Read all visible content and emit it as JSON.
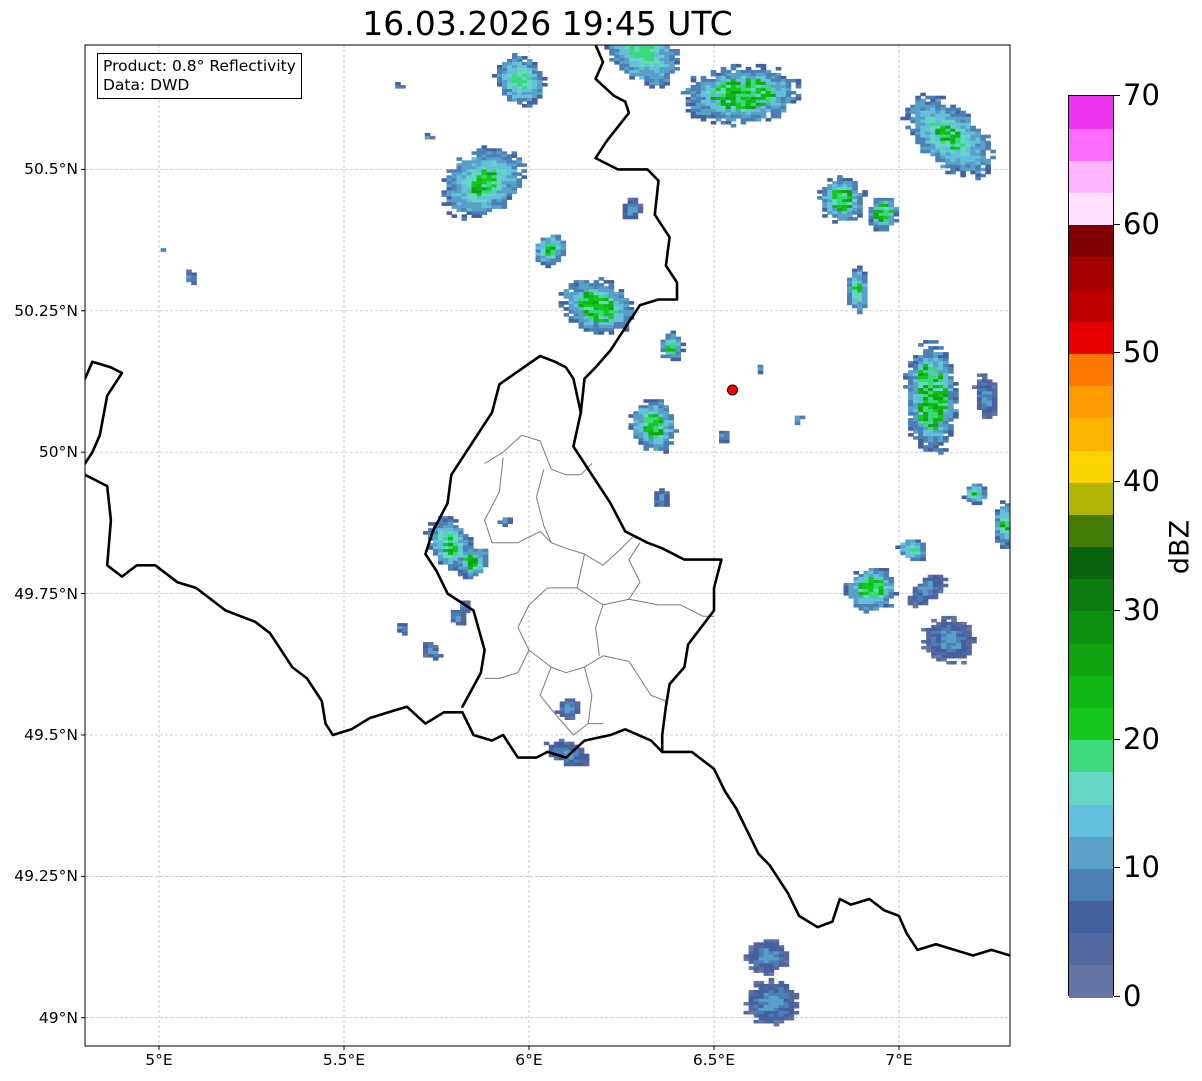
{
  "title": "16.03.2026 19:45 UTC",
  "info": {
    "product": "Product: 0.8° Reflectivity",
    "data": "Data: DWD"
  },
  "map": {
    "lon_range": [
      4.8,
      7.3
    ],
    "lat_range": [
      48.95,
      50.72
    ],
    "x_ticks": [
      {
        "lon": 5.0,
        "label": "5°E"
      },
      {
        "lon": 5.5,
        "label": "5.5°E"
      },
      {
        "lon": 6.0,
        "label": "6°E"
      },
      {
        "lon": 6.5,
        "label": "6.5°E"
      },
      {
        "lon": 7.0,
        "label": "7°E"
      }
    ],
    "y_ticks": [
      {
        "lat": 50.5,
        "label": "50.5°N"
      },
      {
        "lat": 50.25,
        "label": "50.25°N"
      },
      {
        "lat": 50.0,
        "label": "50°N"
      },
      {
        "lat": 49.75,
        "label": "49.75°N"
      },
      {
        "lat": 49.5,
        "label": "49.5°N"
      },
      {
        "lat": 49.25,
        "label": "49.25°N"
      },
      {
        "lat": 49.0,
        "label": "49°N"
      }
    ],
    "radar_site": {
      "lon": 6.55,
      "lat": 50.11
    },
    "colors": {
      "border": "#000000",
      "internal_border": "#7a7a7a",
      "grid": "#b4b4b4",
      "marker": "#ff0000"
    },
    "echoes": [
      {
        "lon": 6.3,
        "lat": 50.71,
        "rlon": 0.11,
        "rlat": 0.05,
        "rot": 40,
        "level": 1,
        "core": 0
      },
      {
        "lon": 6.57,
        "lat": 50.635,
        "rlon": 0.16,
        "rlat": 0.05,
        "rot": -5,
        "level": 1,
        "core": 0.55
      },
      {
        "lon": 5.87,
        "lat": 50.48,
        "rlon": 0.12,
        "rlat": 0.055,
        "rot": -35,
        "level": 1,
        "core": 0.35
      },
      {
        "lon": 5.97,
        "lat": 50.66,
        "rlon": 0.07,
        "rlat": 0.04,
        "rot": 40,
        "level": 1,
        "core": 0
      },
      {
        "lon": 6.05,
        "lat": 50.36,
        "rlon": 0.04,
        "rlat": 0.03,
        "rot": 60,
        "level": 1,
        "core": 0.3
      },
      {
        "lon": 6.18,
        "lat": 50.26,
        "rlon": 0.1,
        "rlat": 0.045,
        "rot": 20,
        "level": 1,
        "core": 0.55
      },
      {
        "lon": 6.27,
        "lat": 50.43,
        "rlon": 0.03,
        "rlat": 0.02,
        "rot": 0,
        "level": 0,
        "core": 0
      },
      {
        "lon": 6.38,
        "lat": 50.19,
        "rlon": 0.03,
        "rlat": 0.025,
        "rot": 0,
        "level": 1,
        "core": 0.5
      },
      {
        "lon": 6.33,
        "lat": 50.05,
        "rlon": 0.075,
        "rlat": 0.04,
        "rot": 70,
        "level": 1,
        "core": 0.45
      },
      {
        "lon": 6.35,
        "lat": 49.92,
        "rlon": 0.025,
        "rlat": 0.015,
        "rot": 80,
        "level": 0,
        "core": 0
      },
      {
        "lon": 6.62,
        "lat": 50.15,
        "rlon": 0.012,
        "rlat": 0.01,
        "rot": 0,
        "level": 0,
        "core": 0
      },
      {
        "lon": 6.52,
        "lat": 50.03,
        "rlon": 0.02,
        "rlat": 0.01,
        "rot": 40,
        "level": 0,
        "core": 0
      },
      {
        "lon": 6.72,
        "lat": 50.06,
        "rlon": 0.012,
        "rlat": 0.01,
        "rot": 0,
        "level": 0,
        "core": 0
      },
      {
        "lon": 6.84,
        "lat": 50.45,
        "rlon": 0.06,
        "rlat": 0.04,
        "rot": -30,
        "level": 1,
        "core": 0.5
      },
      {
        "lon": 6.95,
        "lat": 50.425,
        "rlon": 0.04,
        "rlat": 0.03,
        "rot": 20,
        "level": 1,
        "core": 0.55
      },
      {
        "lon": 6.88,
        "lat": 50.29,
        "rlon": 0.03,
        "rlat": 0.04,
        "rot": 0,
        "level": 1,
        "core": 0.3
      },
      {
        "lon": 7.13,
        "lat": 50.56,
        "rlon": 0.14,
        "rlat": 0.05,
        "rot": 40,
        "level": 1,
        "core": 0.3
      },
      {
        "lon": 7.08,
        "lat": 50.1,
        "rlon": 0.15,
        "rlat": 0.045,
        "rot": 88,
        "level": 1,
        "core": 0.6
      },
      {
        "lon": 7.23,
        "lat": 50.1,
        "rlon": 0.06,
        "rlat": 0.02,
        "rot": 80,
        "level": 0,
        "core": 0
      },
      {
        "lon": 7.2,
        "lat": 49.93,
        "rlon": 0.03,
        "rlat": 0.02,
        "rot": 0,
        "level": 1,
        "core": 0.2
      },
      {
        "lon": 7.28,
        "lat": 49.875,
        "rlon": 0.03,
        "rlat": 0.04,
        "rot": 0,
        "level": 1,
        "core": 0.3
      },
      {
        "lon": 7.03,
        "lat": 49.83,
        "rlon": 0.04,
        "rlat": 0.02,
        "rot": 20,
        "level": 1,
        "core": 0
      },
      {
        "lon": 6.92,
        "lat": 49.76,
        "rlon": 0.07,
        "rlat": 0.04,
        "rot": -10,
        "level": 1,
        "core": 0.5
      },
      {
        "lon": 7.07,
        "lat": 49.76,
        "rlon": 0.06,
        "rlat": 0.02,
        "rot": -40,
        "level": 0,
        "core": 0
      },
      {
        "lon": 7.13,
        "lat": 49.67,
        "rlon": 0.07,
        "rlat": 0.04,
        "rot": 20,
        "level": 0,
        "core": 0
      },
      {
        "lon": 5.78,
        "lat": 49.84,
        "rlon": 0.08,
        "rlat": 0.035,
        "rot": 60,
        "level": 1,
        "core": 0.4
      },
      {
        "lon": 5.84,
        "lat": 49.81,
        "rlon": 0.04,
        "rlat": 0.03,
        "rot": 50,
        "level": 1,
        "core": 0.5
      },
      {
        "lon": 5.8,
        "lat": 49.71,
        "rlon": 0.025,
        "rlat": 0.012,
        "rot": 60,
        "level": 0,
        "core": 0
      },
      {
        "lon": 5.73,
        "lat": 49.65,
        "rlon": 0.03,
        "rlat": 0.012,
        "rot": 45,
        "level": 0,
        "core": 0
      },
      {
        "lon": 5.65,
        "lat": 49.69,
        "rlon": 0.02,
        "rlat": 0.01,
        "rot": 60,
        "level": 0,
        "core": 0
      },
      {
        "lon": 6.1,
        "lat": 49.55,
        "rlon": 0.03,
        "rlat": 0.02,
        "rot": 70,
        "level": 0,
        "core": 0
      },
      {
        "lon": 6.1,
        "lat": 49.47,
        "rlon": 0.06,
        "rlat": 0.02,
        "rot": 20,
        "level": 0,
        "core": 0
      },
      {
        "lon": 6.64,
        "lat": 49.11,
        "rlon": 0.06,
        "rlat": 0.03,
        "rot": 0,
        "level": 0,
        "core": 0
      },
      {
        "lon": 6.65,
        "lat": 49.03,
        "rlon": 0.07,
        "rlat": 0.04,
        "rot": 0,
        "level": 0,
        "core": 0
      },
      {
        "lon": 5.93,
        "lat": 49.88,
        "rlon": 0.015,
        "rlat": 0.01,
        "rot": 0,
        "level": 0,
        "core": 0
      },
      {
        "lon": 5.82,
        "lat": 49.73,
        "rlon": 0.02,
        "rlat": 0.01,
        "rot": 40,
        "level": 0,
        "core": 0
      },
      {
        "lon": 5.08,
        "lat": 50.31,
        "rlon": 0.02,
        "rlat": 0.008,
        "rot": 70,
        "level": 0,
        "core": 0
      },
      {
        "lon": 5.0,
        "lat": 50.36,
        "rlon": 0.008,
        "rlat": 0.006,
        "rot": 0,
        "level": 0,
        "core": 0
      },
      {
        "lon": 5.64,
        "lat": 50.65,
        "rlon": 0.015,
        "rlat": 0.006,
        "rot": 30,
        "level": 0,
        "core": 0
      },
      {
        "lon": 5.72,
        "lat": 50.56,
        "rlon": 0.015,
        "rlat": 0.006,
        "rot": 30,
        "level": 0,
        "core": 0
      }
    ],
    "intl_border": [
      [
        [
          4.8,
          50.13
        ],
        [
          4.82,
          50.16
        ],
        [
          4.87,
          50.15
        ],
        [
          4.9,
          50.14
        ],
        [
          4.86,
          50.1
        ],
        [
          4.84,
          50.03
        ],
        [
          4.82,
          50.0
        ],
        [
          4.8,
          49.98
        ]
      ],
      [
        [
          4.8,
          49.96
        ],
        [
          4.86,
          49.94
        ],
        [
          4.87,
          49.88
        ],
        [
          4.86,
          49.8
        ],
        [
          4.9,
          49.78
        ],
        [
          4.94,
          49.8
        ],
        [
          4.99,
          49.8
        ],
        [
          5.05,
          49.77
        ],
        [
          5.1,
          49.76
        ],
        [
          5.18,
          49.72
        ],
        [
          5.26,
          49.7
        ],
        [
          5.3,
          49.68
        ],
        [
          5.33,
          49.65
        ],
        [
          5.36,
          49.62
        ],
        [
          5.4,
          49.6
        ],
        [
          5.44,
          49.56
        ],
        [
          5.45,
          49.52
        ],
        [
          5.47,
          49.5
        ],
        [
          5.52,
          49.51
        ],
        [
          5.57,
          49.53
        ],
        [
          5.62,
          49.54
        ],
        [
          5.67,
          49.55
        ],
        [
          5.72,
          49.52
        ],
        [
          5.77,
          49.54
        ],
        [
          5.82,
          49.54
        ],
        [
          5.85,
          49.5
        ],
        [
          5.9,
          49.49
        ],
        [
          5.93,
          49.5
        ],
        [
          5.97,
          49.46
        ],
        [
          6.02,
          49.46
        ],
        [
          6.05,
          49.47
        ],
        [
          6.1,
          49.46
        ],
        [
          6.15,
          49.49
        ],
        [
          6.22,
          49.5
        ],
        [
          6.26,
          49.51
        ],
        [
          6.33,
          49.49
        ],
        [
          6.36,
          49.47
        ],
        [
          6.39,
          49.47
        ],
        [
          6.44,
          49.47
        ],
        [
          6.5,
          49.44
        ],
        [
          6.53,
          49.4
        ],
        [
          6.56,
          49.37
        ],
        [
          6.59,
          49.33
        ],
        [
          6.62,
          49.29
        ],
        [
          6.65,
          49.27
        ],
        [
          6.7,
          49.22
        ],
        [
          6.73,
          49.18
        ],
        [
          6.78,
          49.16
        ],
        [
          6.82,
          49.17
        ],
        [
          6.84,
          49.21
        ],
        [
          6.87,
          49.2
        ],
        [
          6.92,
          49.21
        ],
        [
          6.96,
          49.19
        ],
        [
          7.0,
          49.18
        ],
        [
          7.02,
          49.15
        ],
        [
          7.05,
          49.12
        ],
        [
          7.1,
          49.13
        ],
        [
          7.15,
          49.12
        ],
        [
          7.2,
          49.11
        ],
        [
          7.25,
          49.12
        ],
        [
          7.3,
          49.11
        ]
      ],
      [
        [
          6.18,
          50.72
        ],
        [
          6.2,
          50.69
        ],
        [
          6.18,
          50.66
        ],
        [
          6.23,
          50.63
        ],
        [
          6.26,
          50.62
        ],
        [
          6.27,
          50.6
        ],
        [
          6.21,
          50.55
        ],
        [
          6.18,
          50.52
        ],
        [
          6.24,
          50.5
        ],
        [
          6.32,
          50.5
        ],
        [
          6.35,
          50.48
        ],
        [
          6.34,
          50.42
        ],
        [
          6.38,
          50.38
        ],
        [
          6.37,
          50.33
        ],
        [
          6.4,
          50.3
        ],
        [
          6.4,
          50.27
        ],
        [
          6.35,
          50.27
        ],
        [
          6.3,
          50.26
        ],
        [
          6.27,
          50.23
        ],
        [
          6.22,
          50.18
        ],
        [
          6.18,
          50.15
        ],
        [
          6.15,
          50.13
        ],
        [
          6.14,
          50.07
        ],
        [
          6.12,
          50.01
        ],
        [
          6.15,
          49.98
        ],
        [
          6.18,
          49.95
        ],
        [
          6.22,
          49.91
        ],
        [
          6.26,
          49.86
        ],
        [
          6.32,
          49.84
        ],
        [
          6.36,
          49.83
        ],
        [
          6.42,
          49.81
        ],
        [
          6.48,
          49.81
        ],
        [
          6.52,
          49.81
        ],
        [
          6.5,
          49.76
        ],
        [
          6.5,
          49.72
        ],
        [
          6.43,
          49.66
        ],
        [
          6.42,
          49.62
        ],
        [
          6.38,
          49.59
        ],
        [
          6.37,
          49.55
        ],
        [
          6.36,
          49.5
        ],
        [
          6.36,
          49.47
        ]
      ],
      [
        [
          5.82,
          49.55
        ],
        [
          5.87,
          49.61
        ],
        [
          5.88,
          49.65
        ],
        [
          5.85,
          49.72
        ],
        [
          5.78,
          49.75
        ],
        [
          5.75,
          49.79
        ],
        [
          5.72,
          49.82
        ],
        [
          5.74,
          49.86
        ],
        [
          5.78,
          49.91
        ],
        [
          5.79,
          49.96
        ],
        [
          5.84,
          50.01
        ],
        [
          5.9,
          50.07
        ],
        [
          5.92,
          50.12
        ],
        [
          6.03,
          50.17
        ],
        [
          6.07,
          50.16
        ],
        [
          6.1,
          50.15
        ],
        [
          6.12,
          50.13
        ],
        [
          6.13,
          50.1
        ],
        [
          6.14,
          50.07
        ]
      ]
    ],
    "internal_lines": [
      [
        [
          5.88,
          49.98
        ],
        [
          5.93,
          50.0
        ],
        [
          5.98,
          50.03
        ],
        [
          6.03,
          50.02
        ],
        [
          6.06,
          49.97
        ],
        [
          6.1,
          49.96
        ],
        [
          6.14,
          49.96
        ],
        [
          6.17,
          49.98
        ]
      ],
      [
        [
          6.04,
          49.97
        ],
        [
          6.02,
          49.92
        ],
        [
          6.04,
          49.87
        ],
        [
          6.06,
          49.84
        ],
        [
          6.1,
          49.83
        ],
        [
          6.15,
          49.82
        ],
        [
          6.2,
          49.8
        ],
        [
          6.25,
          49.83
        ],
        [
          6.28,
          49.85
        ]
      ],
      [
        [
          5.93,
          49.99
        ],
        [
          5.92,
          49.93
        ],
        [
          5.88,
          49.88
        ],
        [
          5.9,
          49.84
        ],
        [
          5.97,
          49.84
        ],
        [
          6.03,
          49.86
        ],
        [
          6.06,
          49.84
        ]
      ],
      [
        [
          6.15,
          49.82
        ],
        [
          6.13,
          49.76
        ],
        [
          6.2,
          49.73
        ],
        [
          6.27,
          49.74
        ],
        [
          6.3,
          49.77
        ],
        [
          6.27,
          49.81
        ],
        [
          6.3,
          49.84
        ]
      ],
      [
        [
          6.13,
          49.76
        ],
        [
          6.05,
          49.76
        ],
        [
          6.0,
          49.73
        ],
        [
          5.97,
          49.69
        ],
        [
          6.0,
          49.65
        ],
        [
          6.06,
          49.62
        ],
        [
          6.1,
          49.61
        ],
        [
          6.15,
          49.62
        ],
        [
          6.2,
          49.64
        ],
        [
          6.27,
          49.63
        ],
        [
          6.3,
          49.6
        ],
        [
          6.33,
          49.57
        ],
        [
          6.37,
          49.56
        ]
      ],
      [
        [
          6.2,
          49.73
        ],
        [
          6.18,
          49.69
        ],
        [
          6.19,
          49.64
        ]
      ],
      [
        [
          6.27,
          49.74
        ],
        [
          6.35,
          49.73
        ],
        [
          6.41,
          49.73
        ],
        [
          6.47,
          49.71
        ],
        [
          6.5,
          49.71
        ]
      ],
      [
        [
          6.0,
          49.65
        ],
        [
          5.97,
          49.61
        ],
        [
          5.92,
          49.6
        ],
        [
          5.88,
          49.6
        ]
      ],
      [
        [
          6.06,
          49.62
        ],
        [
          6.03,
          49.57
        ],
        [
          6.08,
          49.53
        ],
        [
          6.12,
          49.5
        ],
        [
          6.16,
          49.52
        ],
        [
          6.2,
          49.52
        ]
      ],
      [
        [
          6.15,
          49.62
        ],
        [
          6.17,
          49.57
        ],
        [
          6.16,
          49.52
        ]
      ]
    ]
  },
  "colorbar": {
    "unit": "dBZ",
    "min": 0,
    "max": 70,
    "step": 2.5,
    "colors": [
      "#6474a4",
      "#5468a0",
      "#4460a0",
      "#4c80b4",
      "#58a0c8",
      "#64c0dc",
      "#64d8c4",
      "#3cd87c",
      "#14c81c",
      "#10b814",
      "#10a410",
      "#0c9010",
      "#0c7c10",
      "#08640c",
      "#447c08",
      "#b0b404",
      "#fcd400",
      "#fcb400",
      "#fc9c00",
      "#fc7800",
      "#e80000",
      "#c00000",
      "#a40000",
      "#800000",
      "#ffe0ff",
      "#ffb4ff",
      "#ff6cff",
      "#ec34ec"
    ],
    "ticks": [
      {
        "value": 0,
        "label": "0"
      },
      {
        "value": 10,
        "label": "10"
      },
      {
        "value": 20,
        "label": "20"
      },
      {
        "value": 30,
        "label": "30"
      },
      {
        "value": 40,
        "label": "40"
      },
      {
        "value": 50,
        "label": "50"
      },
      {
        "value": 60,
        "label": "60"
      },
      {
        "value": 70,
        "label": "70"
      }
    ]
  }
}
